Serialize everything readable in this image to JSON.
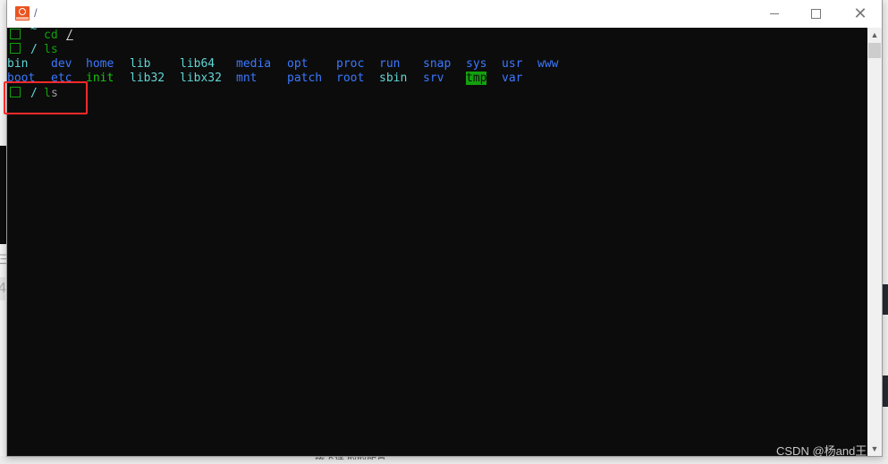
{
  "window": {
    "title": "/",
    "icon": "ubuntu-terminal-icon",
    "controls": {
      "minimize": "minimize-icon",
      "maximize": "maximize-icon",
      "close": "close-icon"
    }
  },
  "terminal": {
    "lines": [
      {
        "prompt_dir": "~",
        "command": "cd",
        "arg": "/"
      },
      {
        "prompt_dir": "/",
        "command": "ls"
      }
    ],
    "ls_output": {
      "row1": [
        {
          "name": "bin",
          "type": "dir"
        },
        {
          "name": "dev",
          "type": "dir"
        },
        {
          "name": "home",
          "type": "dir"
        },
        {
          "name": "lib",
          "type": "link"
        },
        {
          "name": "lib64",
          "type": "link"
        },
        {
          "name": "media",
          "type": "dir"
        },
        {
          "name": "opt",
          "type": "dir"
        },
        {
          "name": "proc",
          "type": "dir"
        },
        {
          "name": "run",
          "type": "dir"
        },
        {
          "name": "snap",
          "type": "dir"
        },
        {
          "name": "sys",
          "type": "dir"
        },
        {
          "name": "usr",
          "type": "dir"
        },
        {
          "name": "www",
          "type": "dir"
        }
      ],
      "row2": [
        {
          "name": "boot",
          "type": "dir"
        },
        {
          "name": "etc",
          "type": "dir"
        },
        {
          "name": "init",
          "type": "exec"
        },
        {
          "name": "lib32",
          "type": "link"
        },
        {
          "name": "libx32",
          "type": "link"
        },
        {
          "name": "mnt",
          "type": "dir"
        },
        {
          "name": "patch",
          "type": "dir"
        },
        {
          "name": "root",
          "type": "dir"
        },
        {
          "name": "sbin",
          "type": "link"
        },
        {
          "name": "srv",
          "type": "dir"
        },
        {
          "name": "tmp",
          "type": "sticky"
        },
        {
          "name": "var",
          "type": "dir"
        }
      ]
    },
    "current_prompt": {
      "prompt_dir": "/",
      "typed_command_first": "l",
      "typed_command_rest": "s"
    }
  },
  "colors": {
    "background": "#0c0c0c",
    "prompt_green": "#13a10e",
    "dir_blue": "#3b78ff",
    "link_cyan": "#61d6d6",
    "highlight_red": "#ff2a2a"
  },
  "watermark": "CSDN @杨and王",
  "background_text": "接下连 的的配置"
}
